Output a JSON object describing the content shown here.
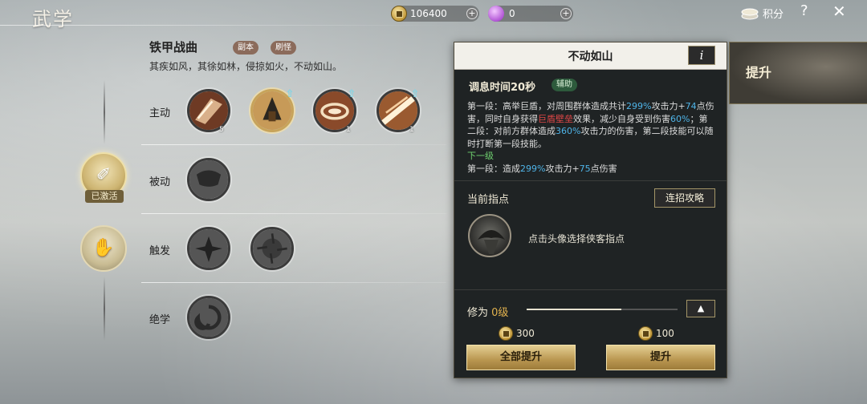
{
  "header": {
    "title": "武学",
    "coins": "106400",
    "gems": "0",
    "score_label": "积分",
    "help": "?",
    "close": "✕",
    "plus": "+"
  },
  "skill_set": {
    "name": "铁甲战曲",
    "tags": [
      "副本",
      "刷怪"
    ],
    "description": "其疾如风，其徐如林，侵掠如火，不动如山。"
  },
  "categories": {
    "active_label": "主动",
    "passive_label": "被动",
    "trigger_label": "触发",
    "ultimate_label": "绝学"
  },
  "badges": {
    "activated_label": "已激活"
  },
  "skills": {
    "active_levels": [
      "5",
      "",
      "1",
      "1"
    ]
  },
  "panel": {
    "title": "不动如山",
    "info": "i",
    "cooldown": "调息时间20秒",
    "role_tag": "辅助",
    "desc_parts": {
      "p1": "第一段：高举巨盾，对周围群体造成共计",
      "v1": "299%",
      "p2": "攻击力+",
      "v2": "74",
      "p3": "点伤害，同时自身获得",
      "v3": "巨盾壁垒",
      "p4": "效果，减少自身受到伤害",
      "v4": "60%",
      "p5": "；第二段：对前方群体造成",
      "v5": "360%",
      "p6": "攻击力的伤害，第二段技能可以随时打断第一段技能。",
      "next": "下一级",
      "n1": "第一段：造成",
      "nv1": "299%",
      "n2": "攻击力+",
      "nv2": "75",
      "n3": "点伤害"
    },
    "current_tip": "当前指点",
    "combo_button": "连招攻略",
    "portrait_hint": "点击头像选择侠客指点",
    "cultivation_label": "修为",
    "cultivation_level": "0级",
    "cultivation_progress": 0.63,
    "cost_all": "300",
    "cost_single": "100",
    "upgrade_all": "全部提升",
    "upgrade": "提升"
  },
  "side_tab": {
    "label": "提升"
  },
  "colors": {
    "gold": "#c8a45a",
    "highlight_blue": "#4fb4e8",
    "highlight_red": "#e04747",
    "next_green": "#6fd06f"
  }
}
